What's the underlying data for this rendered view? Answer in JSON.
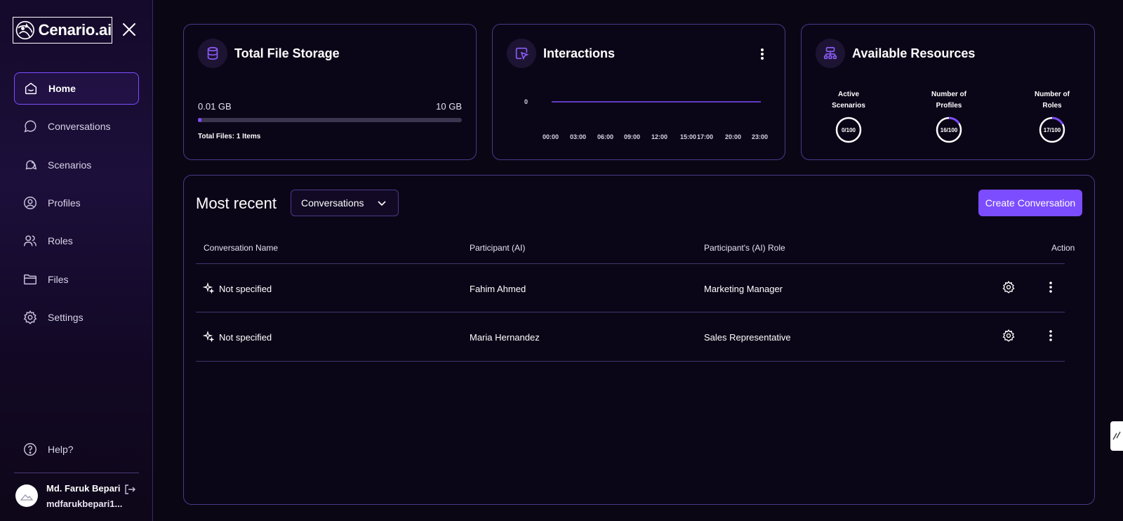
{
  "app": {
    "name": "Cenario.ai"
  },
  "sidebar": {
    "items": [
      {
        "label": "Home",
        "icon": "home-icon"
      },
      {
        "label": "Conversations",
        "icon": "chat-icon"
      },
      {
        "label": "Scenarios",
        "icon": "scenarios-icon"
      },
      {
        "label": "Profiles",
        "icon": "profile-icon"
      },
      {
        "label": "Roles",
        "icon": "users-icon"
      },
      {
        "label": "Files",
        "icon": "folder-icon"
      },
      {
        "label": "Settings",
        "icon": "gear-icon"
      }
    ],
    "help_label": "Help?"
  },
  "user": {
    "name": "Md. Faruk Bepari",
    "email": "mdfarukbepari1..."
  },
  "storage": {
    "title": "Total File Storage",
    "used": "0.01 GB",
    "total": "10 GB",
    "used_fraction": 0.001,
    "files": "Total Files: 1 Items"
  },
  "interactions": {
    "title": "Interactions",
    "chart_data": {
      "type": "line",
      "x": [
        "00:00",
        "03:00",
        "06:00",
        "09:00",
        "12:00",
        "15:00",
        "17:00",
        "20:00",
        "23:00"
      ],
      "y": [
        0,
        0,
        0,
        0,
        0,
        0,
        0,
        0,
        0
      ],
      "ytick_labels": [
        "0"
      ],
      "color": "#7c4dff"
    }
  },
  "resources": {
    "title": "Available Resources",
    "items": [
      {
        "label_line1": "Active",
        "label_line2": "Scenarios",
        "value": "0/100",
        "fraction": 0.0
      },
      {
        "label_line1": "Number of",
        "label_line2": "Profiles",
        "value": "16/100",
        "fraction": 0.16
      },
      {
        "label_line1": "Number of",
        "label_line2": "Roles",
        "value": "17/100",
        "fraction": 0.17
      }
    ]
  },
  "recent": {
    "title": "Most recent",
    "filter_value": "Conversations",
    "create_label": "Create Conversation",
    "columns": [
      "Conversation Name",
      "Participant (AI)",
      "Participant's (AI) Role",
      "Action"
    ],
    "rows": [
      {
        "name": "Not specified",
        "participant": "Fahim Ahmed",
        "role": "Marketing Manager"
      },
      {
        "name": "Not specified",
        "participant": "Maria Hernandez",
        "role": "Sales Representative"
      }
    ]
  },
  "colors": {
    "accent": "#7c4dff",
    "background": "#0b0614",
    "border": "#4a3a8a"
  }
}
